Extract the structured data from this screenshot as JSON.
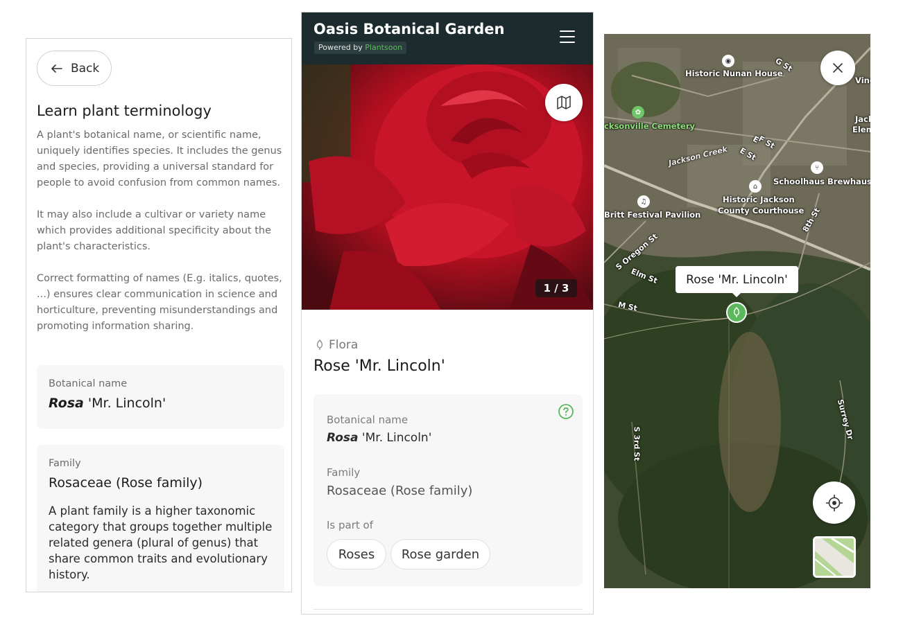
{
  "left_panel": {
    "back_label": "Back",
    "title": "Learn plant terminology",
    "paragraphs": [
      "A plant's botanical name, or scientific name, uniquely identifies species. It includes the genus and species, providing a universal standard for people to avoid confusion from common names.",
      "It may also include a cultivar or variety name which provides additional specificity about the plant's characteristics.",
      "Correct formatting of names (E.g. italics, quotes, ...) ensures clear communication in science and horticulture, preventing misunderstandings and promoting information sharing."
    ],
    "botanical_card": {
      "label": "Botanical name",
      "genus": "Rosa",
      "cultivar": " 'Mr. Lincoln'"
    },
    "family_card": {
      "label": "Family",
      "value": "Rosaceae (Rose family)",
      "description": "A plant family is a higher taxonomic category that groups together multiple related genera (plural of genus) that share common traits and evolutionary history."
    }
  },
  "mid_panel": {
    "garden_title": "Oasis Botanical Garden",
    "powered_by": "Powered by",
    "powered_brand": "Plantsoon",
    "photo_counter": "1 / 3",
    "category": "Flora",
    "plant_name": "Rose 'Mr. Lincoln'",
    "info": {
      "botanical_label": "Botanical name",
      "genus": "Rosa",
      "cultivar": " 'Mr. Lincoln'",
      "family_label": "Family",
      "family_value": "Rosaceae (Rose family)",
      "part_of_label": "Is part of",
      "chips": [
        "Roses",
        "Rose garden"
      ]
    }
  },
  "map_panel": {
    "tooltip": "Rose 'Mr. Lincoln'",
    "labels": {
      "nunan": "Historic Nunan House",
      "cemetery": "cksonville Cemetery",
      "schoolhaus": "Schoolhaus Brewhaus",
      "courthouse_1": "Historic Jackson",
      "courthouse_2": "County Courthouse",
      "pavilion": "Britt Festival Pavilion",
      "wine": "Vine c",
      "jack_1": "Jack",
      "jack_2": "Eleme",
      "g_st": "G St",
      "f_st": "F St",
      "e_st": "E St",
      "ef_st": "E",
      "eighth": "8th St",
      "oregon": "S Oregon St",
      "elm": "Elm St",
      "m_st": "M St",
      "third": "S 3rd St",
      "surrey": "Surrey Dr",
      "creek": "Jackson Creek"
    }
  },
  "colors": {
    "header_bg": "#1c2b2d",
    "brand_green": "#5cb85c",
    "card_bg": "#f7f7f7"
  }
}
